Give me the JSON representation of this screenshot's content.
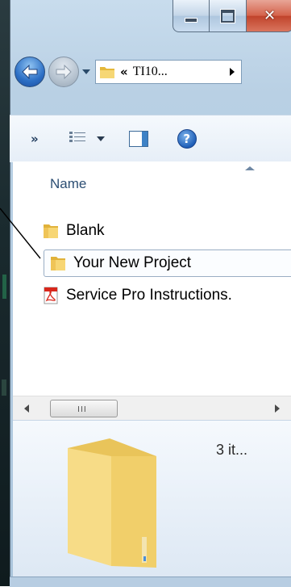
{
  "window": {
    "controls": {
      "minimize": "minimize",
      "maximize": "maximize",
      "close": "close"
    }
  },
  "nav": {
    "address_chevron": "«",
    "address_crumb": "TI10..."
  },
  "toolbar": {
    "more_label": "»"
  },
  "list": {
    "column_header": "Name",
    "items": [
      {
        "label": "Blank",
        "icon": "folder-icon"
      },
      {
        "label": "Your New Project",
        "icon": "folder-icon"
      },
      {
        "label": "Service Pro Instructions.",
        "icon": "pdf-icon"
      }
    ]
  },
  "scrollbar": {
    "grip": "III"
  },
  "details": {
    "item_count": "3 it..."
  },
  "colors": {
    "folder": "#f2c94c",
    "selection_border": "#9aaec4",
    "accent": "#2c6fc5"
  }
}
